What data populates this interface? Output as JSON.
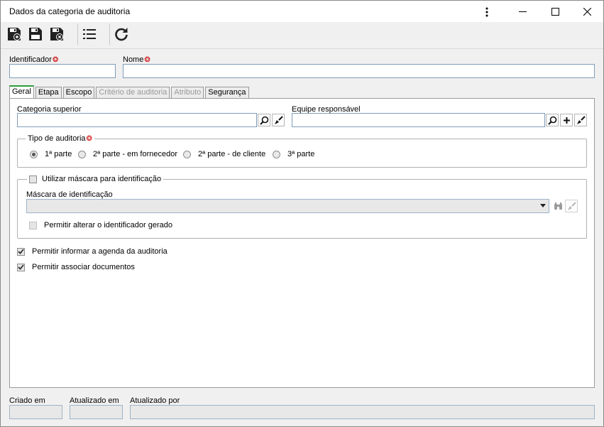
{
  "window": {
    "title": "Dados da categoria de auditoria"
  },
  "header_fields": {
    "identificador_label": "Identificador",
    "identificador_value": "",
    "nome_label": "Nome",
    "nome_value": ""
  },
  "tabs": [
    {
      "label": "Geral",
      "active": true,
      "enabled": true
    },
    {
      "label": "Etapa",
      "active": false,
      "enabled": true
    },
    {
      "label": "Escopo",
      "active": false,
      "enabled": true
    },
    {
      "label": "Critério de auditoria",
      "active": false,
      "enabled": false
    },
    {
      "label": "Atributo",
      "active": false,
      "enabled": false
    },
    {
      "label": "Segurança",
      "active": false,
      "enabled": true
    }
  ],
  "geral": {
    "categoria_superior_label": "Categoria superior",
    "categoria_superior_value": "",
    "equipe_responsavel_label": "Equipe responsável",
    "equipe_responsavel_value": "",
    "tipo_auditoria": {
      "label": "Tipo de auditoria",
      "options": [
        "1ª parte",
        "2ª parte - em fornecedor",
        "2ª parte - de cliente",
        "3ª parte"
      ],
      "selected": "1ª parte"
    },
    "mascara_group": {
      "checkbox_label": "Utilizar máscara para identificação",
      "checked": false,
      "mascara_label": "Máscara de identificação",
      "mascara_value": "",
      "permitir_alterar_label": "Permitir alterar o identificador gerado",
      "permitir_alterar_checked": false
    },
    "permitir_agenda_label": "Permitir informar a agenda da auditoria",
    "permitir_agenda_checked": true,
    "permitir_documentos_label": "Permitir associar documentos",
    "permitir_documentos_checked": true
  },
  "footer": {
    "criado_em_label": "Criado em",
    "criado_em_value": "",
    "atualizado_em_label": "Atualizado em",
    "atualizado_em_value": "",
    "atualizado_por_label": "Atualizado por",
    "atualizado_por_value": ""
  },
  "icons": {
    "required": "required-icon",
    "search": "search-icon",
    "clear": "clear-icon",
    "add": "add-icon",
    "dropdown": "chevron-down-icon"
  },
  "colors": {
    "active_tab_accent": "#2e9d41",
    "required_marker": "#cc0000",
    "input_border": "#7f9db9"
  }
}
